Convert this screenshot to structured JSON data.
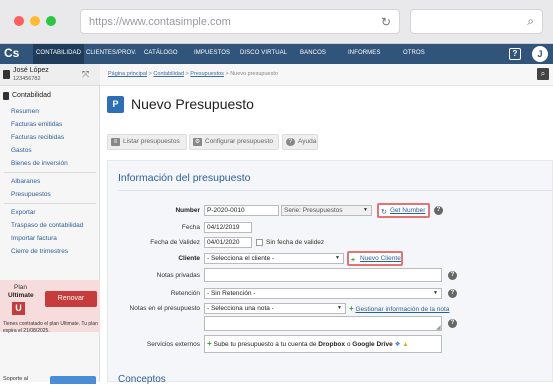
{
  "browser": {
    "url": "https://www.contasimple.com",
    "reload_icon": "reload-icon",
    "search_icon": "search-icon",
    "traffic_lights": [
      "#ff5f57",
      "#febc2e",
      "#28c840"
    ]
  },
  "nav": {
    "logo": "Cs",
    "items": [
      "CONTABILIDAD",
      "CLIENTES/PROV.",
      "CATÁLOGO",
      "IMPUESTOS",
      "DISCO VIRTUAL",
      "BANCOS",
      "INFORMES",
      "OTROS"
    ],
    "active_index": 0,
    "help": "?",
    "avatar": "J",
    "color": "#30547a"
  },
  "user": {
    "name": "José López",
    "id": "123456782"
  },
  "sidebar": {
    "section": "Contabilidad",
    "group1": [
      "Resumen",
      "Facturas emitidas",
      "Facturas recibidas",
      "Gastos",
      "Bienes de inversión"
    ],
    "group2": [
      "Albaranes",
      "Presupuestos"
    ],
    "group3": [
      "Exportar",
      "Traspaso de contabilidad",
      "Importar factura",
      "Cierre de trimestres"
    ],
    "plan_label": "Plan",
    "plan_name": "Ultimate",
    "plan_badge": "U",
    "renew": "Renovar",
    "plan_note": "Tienes contratado el plan Ultimate. Tu plan expira el 21/08/2025.",
    "support": "Soporte al"
  },
  "breadcrumb": {
    "home": "Página principal",
    "section": "Contabilidad",
    "list": "Presupuestos",
    "current": "Nuevo presupuesto",
    "sep": " > "
  },
  "page": {
    "title": "Nuevo Presupuesto",
    "icon": "document-icon"
  },
  "toolbar": {
    "list": "Listar presupuestos",
    "config": "Configurar presupuesto",
    "help": "Ayuda"
  },
  "form": {
    "title": "Información del presupuesto",
    "number_label": "Number",
    "number_value": "P-2020-0010",
    "series_label": "Serie: Presupuestos",
    "get_number": "Get Number",
    "date_label": "Fecha",
    "date_value": "04/12/2019",
    "valid_label": "Fecha de Validez",
    "valid_value": "04/01/2020",
    "no_valid_date": "Sin fecha de validez",
    "client_label": "Cliente",
    "client_value": "- Selecciona el cliente -",
    "new_client": "Nuevo Cliente",
    "private_notes_label": "Notas privadas",
    "retention_label": "Retención",
    "retention_value": "- Sin Retención -",
    "notes_label": "Notas en el presupuesto",
    "notes_value": "- Selecciona una nota -",
    "manage_notes": "Gestionar información de la nota",
    "external_label": "Servicios externos",
    "external_pre": "Sube tu presupuesto a tu cuenta de",
    "external_dropbox": "Dropbox",
    "external_or": "o",
    "external_drive": "Google Drive",
    "help_mark": "?"
  },
  "section2": {
    "title": "Conceptos"
  }
}
